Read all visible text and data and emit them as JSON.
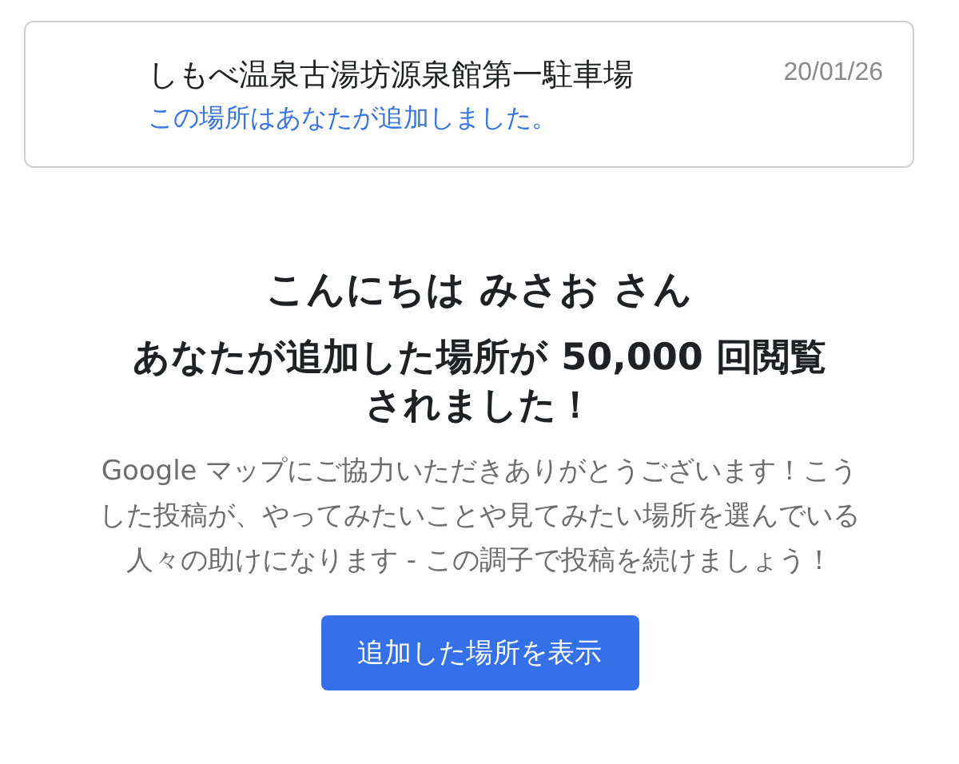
{
  "place_card": {
    "name": "しもべ温泉古湯坊源泉館第一駐車場",
    "note": "この場所はあなたが追加しました。",
    "date": "20/01/26"
  },
  "greeting": "こんにちは みさお さん",
  "headline": "あなたが追加した場所が 50,000 回閲覧されました！",
  "message": "Google マップにご協力いただきありがとうございます！こうした投稿が、やってみたいことや見てみたい場所を選んでいる人々の助けになります - この調子で投稿を続けましょう！",
  "button": "追加した場所を表示"
}
